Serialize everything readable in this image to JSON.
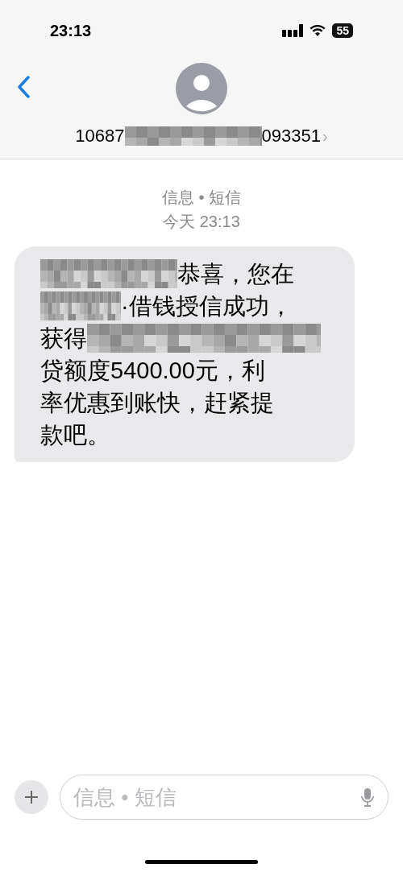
{
  "status_bar": {
    "time": "23:13",
    "battery": "55"
  },
  "contact": {
    "number_parts": [
      {
        "kind": "text",
        "text": "10687"
      },
      {
        "kind": "redacted"
      },
      {
        "kind": "text",
        "text": "093351"
      }
    ],
    "chevron": "›"
  },
  "thread_header": {
    "service": "信息 • 短信",
    "timestamp": "今天 23:13"
  },
  "message": {
    "lines": [
      [
        {
          "kind": "redacted"
        },
        {
          "kind": "text",
          "text": "恭喜，您在"
        }
      ],
      [
        {
          "kind": "redacted"
        },
        {
          "kind": "text",
          "text": "·借钱授信成功，"
        }
      ],
      [
        {
          "kind": "text",
          "text": "获得"
        },
        {
          "kind": "redacted"
        }
      ],
      [
        {
          "kind": "text",
          "text": "贷额度5400.00元，利"
        }
      ],
      [
        {
          "kind": "text",
          "text": "率优惠到账快，赶紧提"
        }
      ],
      [
        {
          "kind": "text",
          "text": "款吧。"
        }
      ]
    ]
  },
  "composer": {
    "placeholder": "信息 • 短信"
  }
}
